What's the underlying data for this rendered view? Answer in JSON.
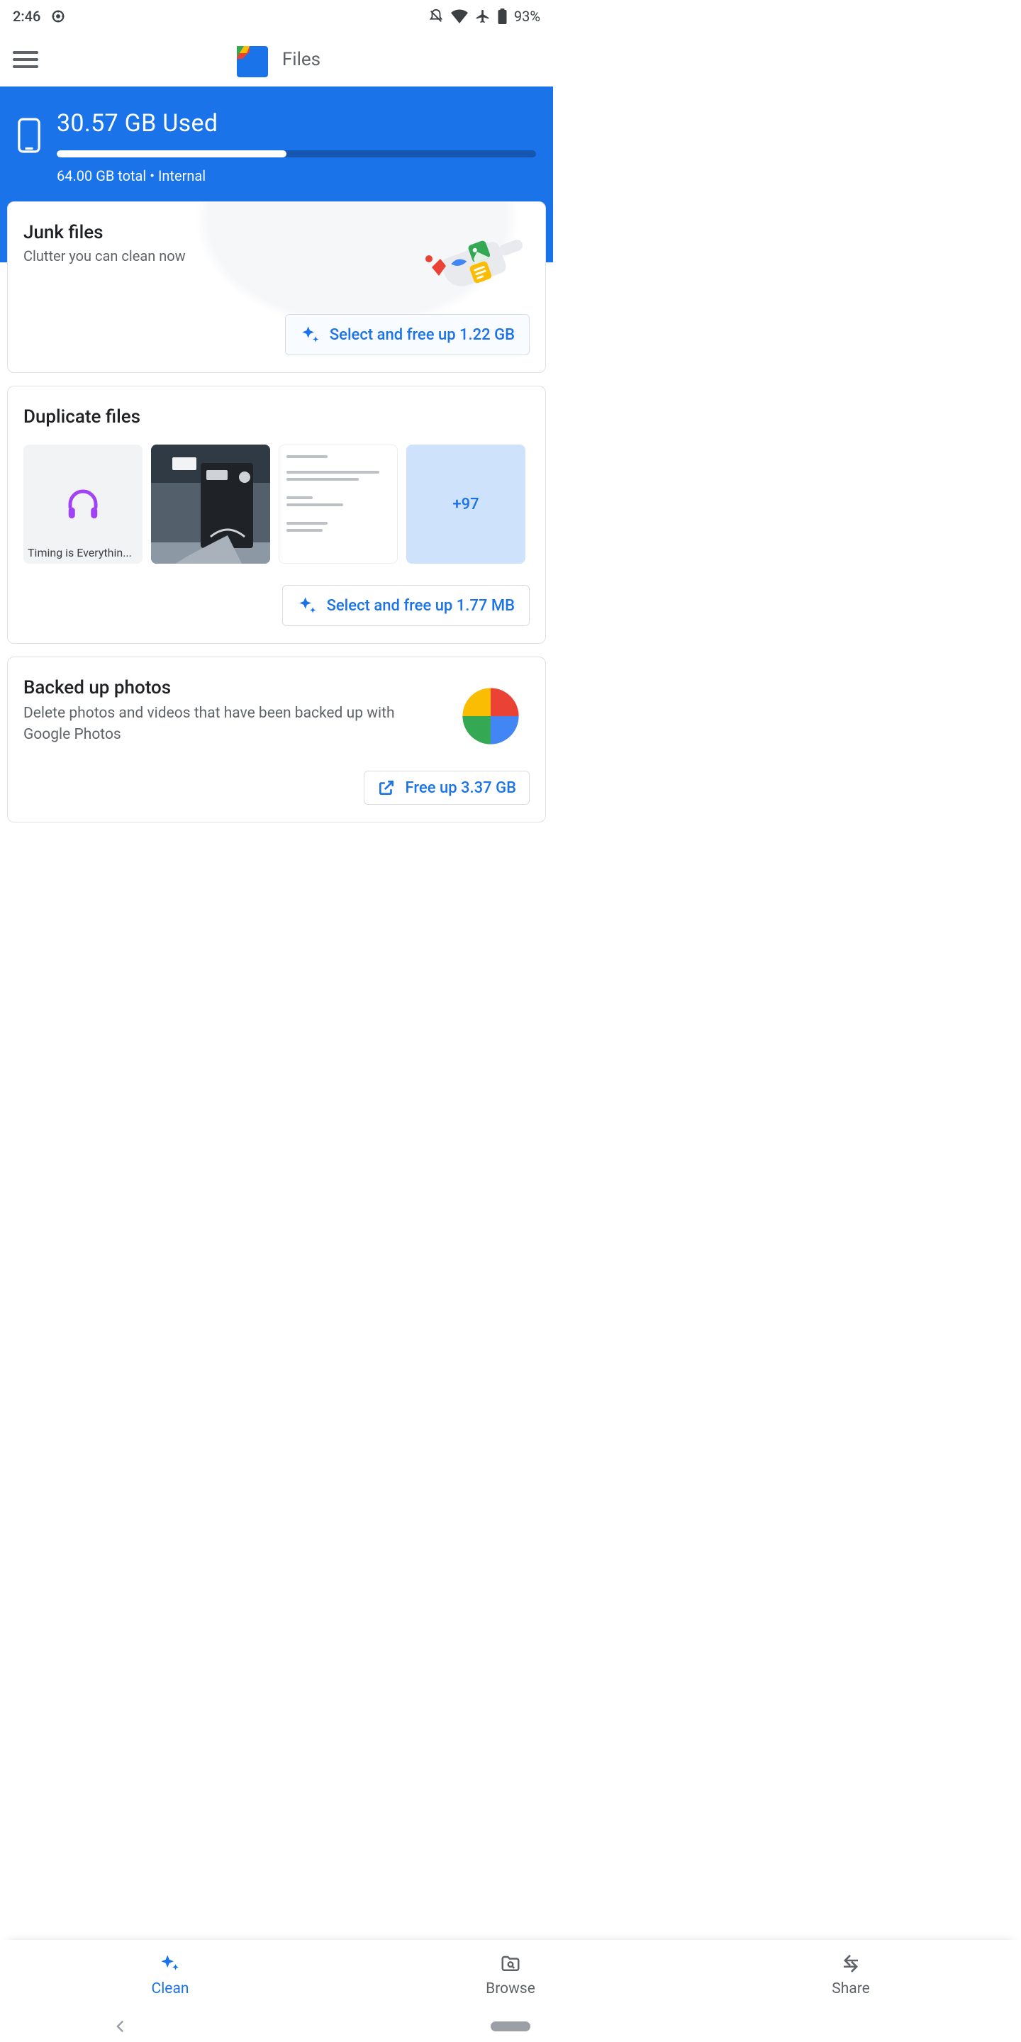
{
  "status": {
    "time": "2:46",
    "battery_pct": "93%"
  },
  "app": {
    "title": "Files"
  },
  "storage": {
    "used_label": "30.57 GB Used",
    "total_label": "64.00 GB total • Internal",
    "pct": 48
  },
  "junk": {
    "title": "Junk files",
    "subtitle": "Clutter you can clean now",
    "action": "Select and free up 1.22 GB"
  },
  "duplicates": {
    "title": "Duplicate files",
    "thumbs": {
      "audio_caption": "Timing is Everythin...",
      "more_label": "+97"
    },
    "action": "Select and free up 1.77 MB"
  },
  "backedup": {
    "title": "Backed up photos",
    "subtitle": "Delete photos and videos that have been backed up with Google Photos",
    "action": "Free up 3.37 GB"
  },
  "nav": {
    "clean": "Clean",
    "browse": "Browse",
    "share": "Share"
  }
}
